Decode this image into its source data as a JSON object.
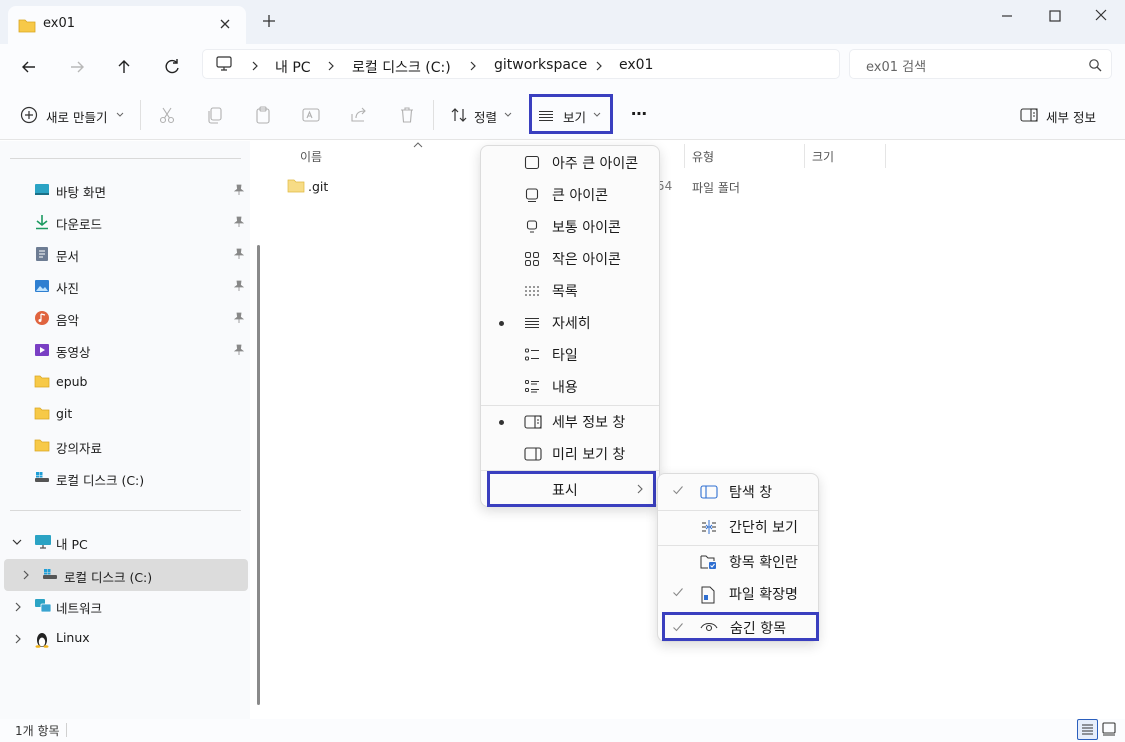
{
  "window": {
    "tab_title": "ex01",
    "new_tab": "+"
  },
  "address": {
    "crumbs": [
      "내 PC",
      "로컬 디스크 (C:)",
      "gitworkspace",
      "ex01"
    ],
    "search_placeholder": "ex01 검색"
  },
  "toolbar": {
    "new_label": "새로 만들기",
    "sort_label": "정렬",
    "view_label": "보기",
    "more": "⋯",
    "details_label": "세부 정보"
  },
  "sidebar": {
    "quick": [
      {
        "label": "바탕 화면",
        "icon": "desktop-icon",
        "pinned": true
      },
      {
        "label": "다운로드",
        "icon": "download-icon",
        "pinned": true
      },
      {
        "label": "문서",
        "icon": "document-icon",
        "pinned": true
      },
      {
        "label": "사진",
        "icon": "pictures-icon",
        "pinned": true
      },
      {
        "label": "음악",
        "icon": "music-icon",
        "pinned": true
      },
      {
        "label": "동영상",
        "icon": "video-icon",
        "pinned": true
      },
      {
        "label": "epub",
        "icon": "folder-icon",
        "pinned": false
      },
      {
        "label": "git",
        "icon": "folder-icon",
        "pinned": false
      },
      {
        "label": "강의자료",
        "icon": "folder-icon",
        "pinned": false
      },
      {
        "label": "로컬 디스크 (C:)",
        "icon": "drive-icon",
        "pinned": false
      }
    ],
    "tree": [
      {
        "label": "내 PC",
        "icon": "pc-icon"
      },
      {
        "label": "로컬 디스크 (C:)",
        "icon": "drive-icon"
      },
      {
        "label": "네트워크",
        "icon": "network-icon"
      },
      {
        "label": "Linux",
        "icon": "linux-icon"
      }
    ]
  },
  "content": {
    "columns": [
      "이름",
      "유형",
      "크기"
    ],
    "rows": [
      {
        "name": ".git",
        "date_fragment": "54",
        "type": "파일 폴더"
      }
    ]
  },
  "view_menu": {
    "items": [
      {
        "label": "아주 큰 아이콘",
        "icon": "extra-large-icons-icon",
        "selected": false
      },
      {
        "label": "큰 아이콘",
        "icon": "large-icons-icon",
        "selected": false
      },
      {
        "label": "보통 아이콘",
        "icon": "medium-icons-icon",
        "selected": false
      },
      {
        "label": "작은 아이콘",
        "icon": "small-icons-icon",
        "selected": false
      },
      {
        "label": "목록",
        "icon": "list-icon",
        "selected": false
      },
      {
        "label": "자세히",
        "icon": "details-icon",
        "selected": true
      },
      {
        "label": "타일",
        "icon": "tiles-icon",
        "selected": false
      },
      {
        "label": "내용",
        "icon": "content-icon",
        "selected": false
      },
      {
        "label": "세부 정보 창",
        "icon": "details-pane-icon",
        "selected": true
      },
      {
        "label": "미리 보기 창",
        "icon": "preview-pane-icon",
        "selected": false
      }
    ],
    "show_label": "표시"
  },
  "show_submenu": {
    "items": [
      {
        "label": "탐색 창",
        "icon": "navigation-pane-icon",
        "checked": true
      },
      {
        "label": "간단히 보기",
        "icon": "compact-view-icon",
        "checked": false
      },
      {
        "label": "항목 확인란",
        "icon": "item-checkboxes-icon",
        "checked": false
      },
      {
        "label": "파일 확장명",
        "icon": "file-extensions-icon",
        "checked": true
      },
      {
        "label": "숨긴 항목",
        "icon": "hidden-items-icon",
        "checked": true
      }
    ]
  },
  "status": {
    "count": "1개 항목"
  },
  "colors": {
    "highlight": "#3a3fbf",
    "folder": "#f7c948",
    "accent": "#0067c0"
  }
}
